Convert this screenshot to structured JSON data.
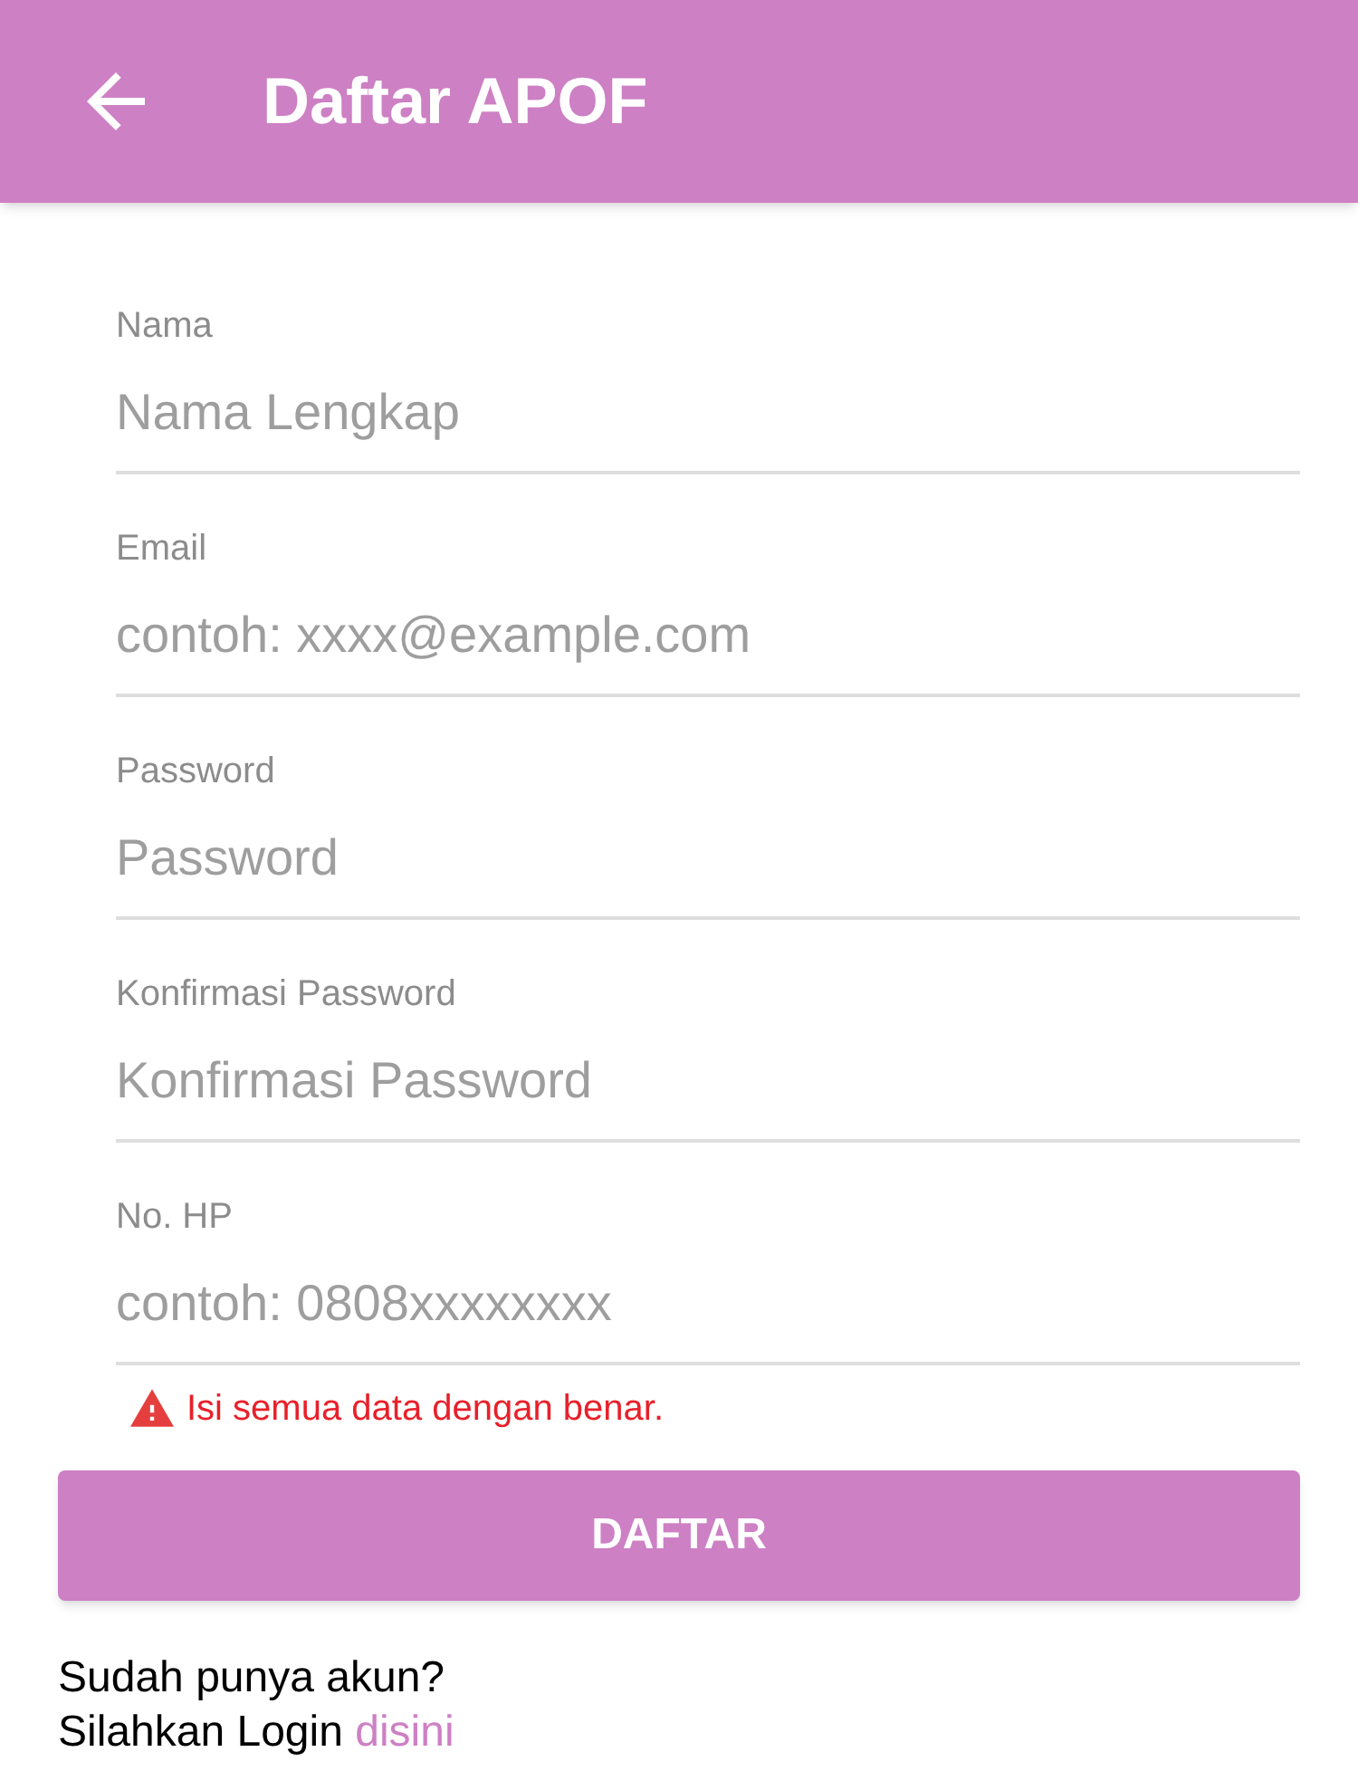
{
  "app_bar": {
    "title": "Daftar APOF"
  },
  "fields": [
    {
      "label": "Nama",
      "placeholder": "Nama Lengkap"
    },
    {
      "label": "Email",
      "placeholder": "contoh: xxxx@example.com"
    },
    {
      "label": "Password",
      "placeholder": "Password"
    },
    {
      "label": "Konfirmasi Password",
      "placeholder": "Konfirmasi Password"
    },
    {
      "label": "No. HP",
      "placeholder": "contoh: 0808xxxxxxxx"
    }
  ],
  "error": {
    "text": "Isi semua data dengan benar."
  },
  "submit_button": {
    "label": "DAFTAR"
  },
  "footer": {
    "question": "Sudah punya akun?",
    "prompt": "Silahkan Login ",
    "link": "disini"
  }
}
